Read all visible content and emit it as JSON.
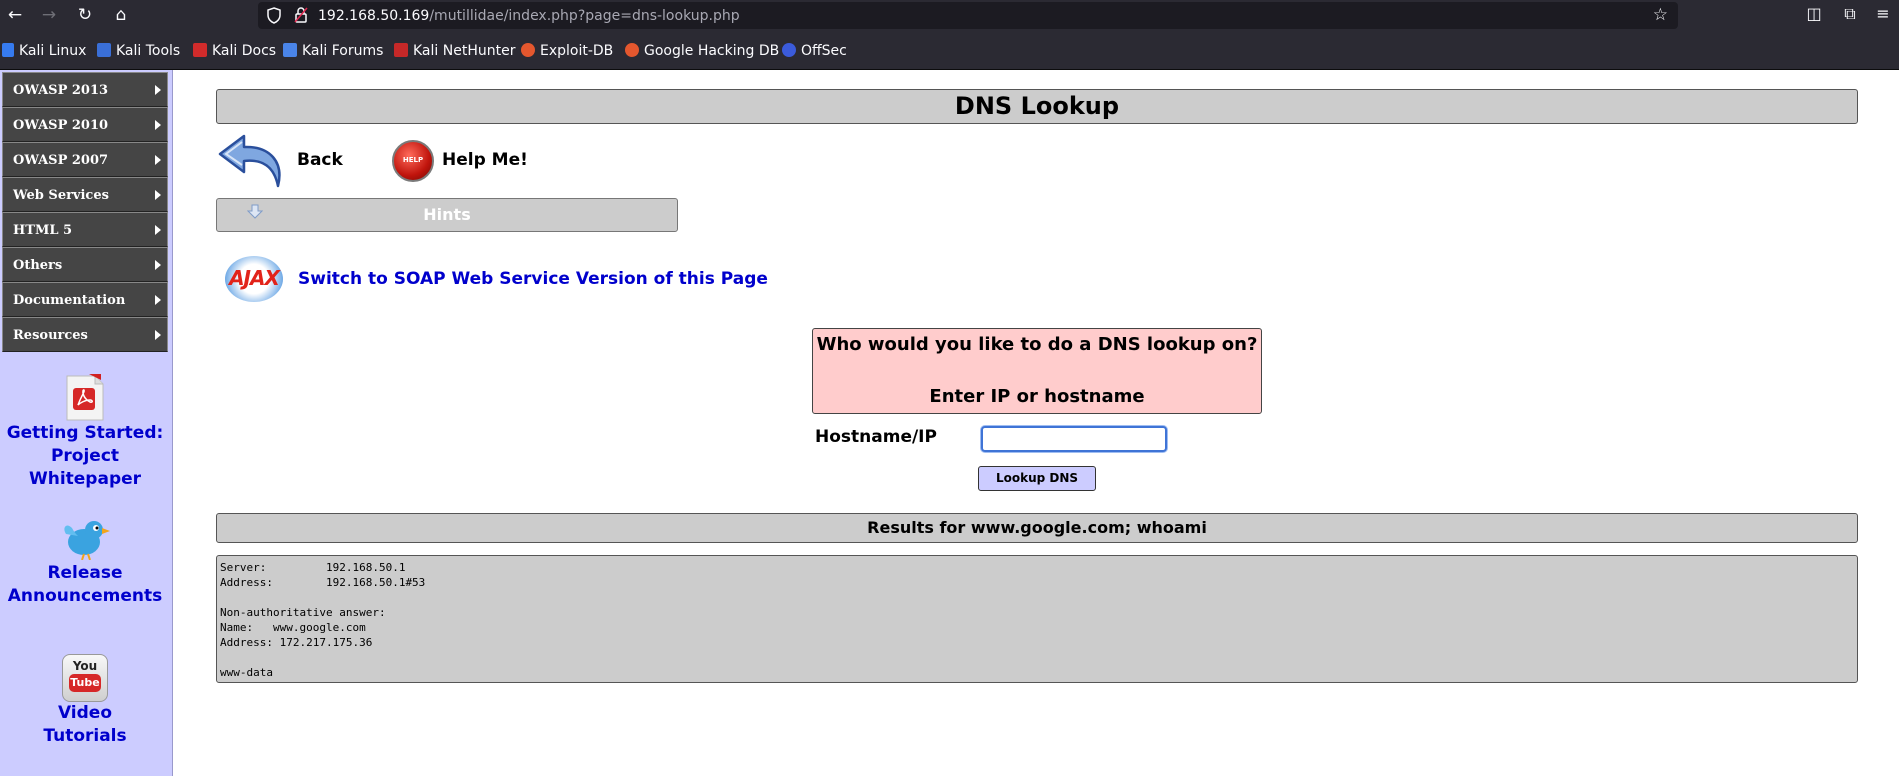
{
  "browser": {
    "url_host": "192.168.50.169",
    "url_path": "/mutillidae/index.php?page=dns-lookup.php",
    "bookmarks": [
      "Kali Linux",
      "Kali Tools",
      "Kali Docs",
      "Kali Forums",
      "Kali NetHunter",
      "Exploit-DB",
      "Google Hacking DB",
      "OffSec"
    ]
  },
  "sidebar": {
    "menu": [
      "OWASP 2013",
      "OWASP 2010",
      "OWASP 2007",
      "Web Services",
      "HTML 5",
      "Others",
      "Documentation",
      "Resources"
    ],
    "whitepaper_line1": "Getting Started:",
    "whitepaper_line2": "Project Whitepaper",
    "release_line1": "Release",
    "release_line2": "Announcements",
    "video_line1": "Video",
    "video_line2": "Tutorials",
    "youtube_top": "You",
    "youtube_bottom": "Tube"
  },
  "main": {
    "title": "DNS Lookup",
    "back_label": "Back",
    "help_label": "Help Me!",
    "help_badge": "HELP",
    "hints_label": "Hints",
    "ajax_logo": "AJAX",
    "soap_link": "Switch to SOAP Web Service Version of this Page",
    "prompt_line1": "Who would you like to do a DNS lookup on?",
    "prompt_line2": "Enter IP or hostname",
    "field_label": "Hostname/IP",
    "field_value": "",
    "button_label": "Lookup DNS",
    "results_title": "Results for www.google.com; whoami",
    "results_text": "Server:\t\t192.168.50.1\nAddress:\t192.168.50.1#53\n\nNon-authoritative answer:\nName:\twww.google.com\nAddress: 172.217.175.36\n\nwww-data"
  }
}
